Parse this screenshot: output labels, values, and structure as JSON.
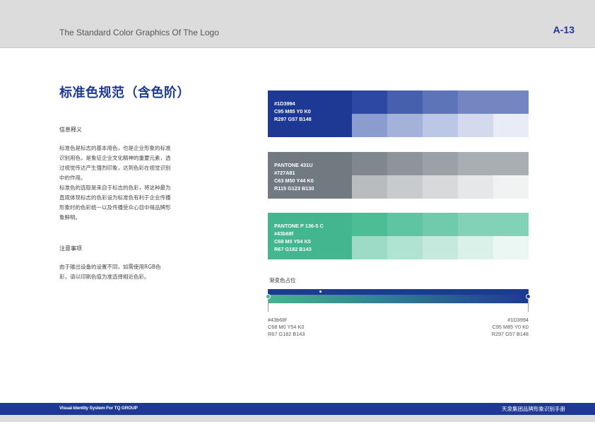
{
  "header": {
    "title": "The Standard Color Graphics Of The Logo",
    "page_number": "A-13"
  },
  "content": {
    "title": "标准色规范（含色阶）",
    "section1_heading": "信息释义",
    "section1_lines": [
      "标准色是标志的基本用色，也是企业形象的标准",
      "识别用色，是象征企业文化精神的重要元素，透",
      "过视觉传达产生强烈印象，达到色彩在视觉识别",
      "中的作用。",
      "标准色的选取是来自于标志的色彩，将这种最为",
      "直观体现标志的色彩设为标准色有利于企业传播",
      "形象时的色彩统一以及传播受众心目中得品牌形",
      "象鲜明。"
    ],
    "section2_heading": "注意事项",
    "section2_lines": [
      "由于输出设备的设置不同，如需使用RGB色",
      "彩，请以印刷色值为准选择相近色彩。"
    ]
  },
  "swatches": [
    {
      "lines": [
        "#1D3994",
        "C95 M85 Y0 K0",
        "R297 G57 B148"
      ],
      "base": "#1D3994",
      "top_tints": [
        "#2d48a0",
        "#4760ad",
        "#5d74b8",
        "#7486c2"
      ],
      "bottom_tints": [
        "#8b9dcf",
        "#a4b2da",
        "#bcc6e5",
        "#d3daee",
        "#e8ecf6"
      ]
    },
    {
      "lines": [
        "PANTONE  431U",
        "#727A81",
        "C63 M50 Y44 K0",
        "R115 G123 B130"
      ],
      "base": "#727A81",
      "top_tints": [
        "#80878d",
        "#8e949a",
        "#9ba1a6",
        "#a9aeb2"
      ],
      "bottom_tints": [
        "#b8bcbf",
        "#c8cbcd",
        "#d7d9db",
        "#e5e7e8",
        "#f1f2f2"
      ]
    },
    {
      "lines": [
        "PANTONE P 136-5 C",
        "#43b68f",
        "C68 M0 Y54 K0",
        "R67 G182 B143"
      ],
      "base": "#43b68f",
      "top_tints": [
        "#4dbd96",
        "#5ec4a1",
        "#70caac",
        "#82d2b7"
      ],
      "bottom_tints": [
        "#9ddbc6",
        "#b1e3d2",
        "#c5eadd",
        "#d9f1e8",
        "#ebf7f3"
      ]
    }
  ],
  "gradient": {
    "label": "渐变色占位",
    "start_color": "#43b68f",
    "end_color": "#1D3994",
    "start_spec": [
      "#43b68f",
      "C68 M0 Y54 K0",
      "R67 G182 B143"
    ],
    "end_spec": [
      "#1D3994",
      "C95 M85 Y0 K0",
      "R297 G57 B148"
    ]
  },
  "footer": {
    "left": "Visual Identity System For TQ GROUP",
    "right": "天泉集团品牌形象识别手册"
  }
}
